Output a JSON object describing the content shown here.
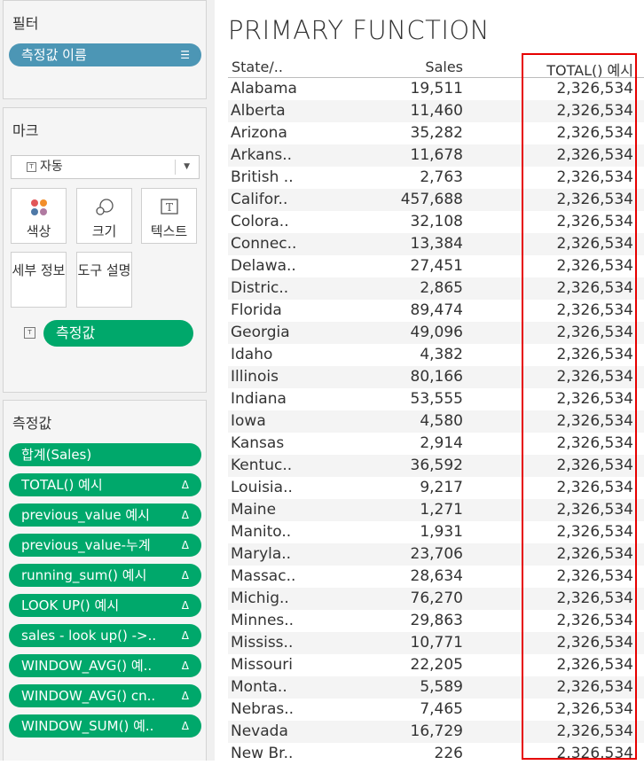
{
  "filters": {
    "title": "필터",
    "pill": "측정값 이름"
  },
  "marks": {
    "title": "마크",
    "type": "자동",
    "buttons": {
      "color": "색상",
      "size": "크기",
      "text": "텍스트",
      "detail": "세부 정보",
      "tooltip": "도구 설명"
    },
    "pill": "측정값"
  },
  "measures": {
    "title": "측정값",
    "pills": [
      "합계(Sales)",
      "TOTAL() 예시",
      "previous_value 예시",
      "previous_value-누계",
      "running_sum() 예시",
      "LOOK UP() 예시",
      "sales - look up() ->..",
      "WINDOW_AVG() 예..",
      "WINDOW_AVG() cn..",
      "WINDOW_SUM() 예.."
    ]
  },
  "view": {
    "title": "PRIMARY FUNCTION",
    "columns": [
      "State/..",
      "Sales",
      "TOTAL() 예시"
    ],
    "rows": [
      [
        "Alabama",
        "19,511",
        "2,326,534"
      ],
      [
        "Alberta",
        "11,460",
        "2,326,534"
      ],
      [
        "Arizona",
        "35,282",
        "2,326,534"
      ],
      [
        "Arkans..",
        "11,678",
        "2,326,534"
      ],
      [
        "British ..",
        "2,763",
        "2,326,534"
      ],
      [
        "Califor..",
        "457,688",
        "2,326,534"
      ],
      [
        "Colora..",
        "32,108",
        "2,326,534"
      ],
      [
        "Connec..",
        "13,384",
        "2,326,534"
      ],
      [
        "Delawa..",
        "27,451",
        "2,326,534"
      ],
      [
        "Distric..",
        "2,865",
        "2,326,534"
      ],
      [
        "Florida",
        "89,474",
        "2,326,534"
      ],
      [
        "Georgia",
        "49,096",
        "2,326,534"
      ],
      [
        "Idaho",
        "4,382",
        "2,326,534"
      ],
      [
        "Illinois",
        "80,166",
        "2,326,534"
      ],
      [
        "Indiana",
        "53,555",
        "2,326,534"
      ],
      [
        "Iowa",
        "4,580",
        "2,326,534"
      ],
      [
        "Kansas",
        "2,914",
        "2,326,534"
      ],
      [
        "Kentuc..",
        "36,592",
        "2,326,534"
      ],
      [
        "Louisia..",
        "9,217",
        "2,326,534"
      ],
      [
        "Maine",
        "1,271",
        "2,326,534"
      ],
      [
        "Manito..",
        "1,931",
        "2,326,534"
      ],
      [
        "Maryla..",
        "23,706",
        "2,326,534"
      ],
      [
        "Massac..",
        "28,634",
        "2,326,534"
      ],
      [
        "Michig..",
        "76,270",
        "2,326,534"
      ],
      [
        "Minnes..",
        "29,863",
        "2,326,534"
      ],
      [
        "Mississ..",
        "10,771",
        "2,326,534"
      ],
      [
        "Missouri",
        "22,205",
        "2,326,534"
      ],
      [
        "Monta..",
        "5,589",
        "2,326,534"
      ],
      [
        "Nebras..",
        "7,465",
        "2,326,534"
      ],
      [
        "Nevada",
        "16,729",
        "2,326,534"
      ],
      [
        "New Br..",
        "226",
        "2,326,534"
      ]
    ]
  },
  "colors": {
    "filter_pill": "#4c96b5",
    "measure_pill": "#00a86b",
    "highlight": "#e60000"
  }
}
